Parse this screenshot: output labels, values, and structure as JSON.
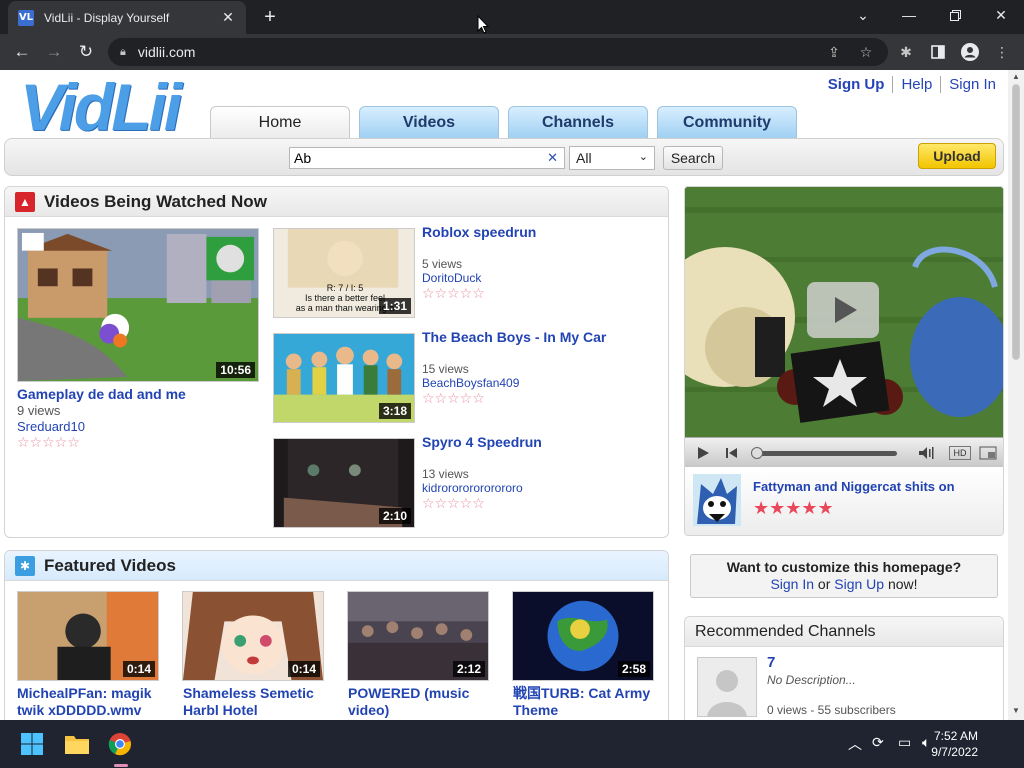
{
  "browser": {
    "tab_title": "VidLii - Display Yourself",
    "favicon_text": "VL",
    "url": "vidlii.com"
  },
  "site": {
    "logo": "VidLii",
    "user_links": {
      "signup": "Sign Up",
      "help": "Help",
      "signin": "Sign In"
    },
    "nav_tabs": [
      "Home",
      "Videos",
      "Channels",
      "Community"
    ],
    "active_tab": "Home",
    "search": {
      "value": "Ab",
      "clear": "✕",
      "category": "All",
      "button": "Search"
    },
    "upload": "Upload"
  },
  "watched_now": {
    "title": "Videos Being Watched Now",
    "main": {
      "title": "Gameplay de dad and me",
      "views": "9 views",
      "author": "Sreduard10",
      "duration": "10:56"
    },
    "list": [
      {
        "title": "Roblox speedrun",
        "views": "5 views",
        "author": "DoritoDuck",
        "duration": "1:31",
        "thumb_caption": "R: 7 / I: 5\nIs there a better feel\nas a man than wearing a"
      },
      {
        "title": "The Beach Boys - In My Car",
        "views": "15 views",
        "author": "BeachBoysfan409",
        "duration": "3:18"
      },
      {
        "title": "Spyro 4 Speedrun",
        "views": "13 views",
        "author": "kidrorororororororo",
        "duration": "2:10"
      }
    ]
  },
  "featured": {
    "title": "Featured Videos",
    "items": [
      {
        "title": "MichealPFan: magik twik xDDDDD.wmv",
        "duration": "0:14"
      },
      {
        "title": "Shameless Semetic Harbl Hotel",
        "duration": "0:14"
      },
      {
        "title": "POWERED (music video)",
        "duration": "2:12"
      },
      {
        "title": "戦国TURB: Cat Army Theme",
        "duration": "2:58"
      }
    ]
  },
  "player": {
    "now_playing": "Fattyman and Niggercat shits on",
    "stars_filled": 5,
    "hd": "HD"
  },
  "promo": {
    "question": "Want to customize this homepage?",
    "signin": "Sign In",
    "or": "or",
    "signup": "Sign Up",
    "now": "now!"
  },
  "recommended": {
    "title": "Recommended Channels",
    "channel": {
      "name": "7",
      "description": "No Description...",
      "stats": "0 views - 55 subscribers"
    }
  },
  "taskbar": {
    "time": "7:52 AM",
    "date": "9/7/2022"
  },
  "colors": {
    "link": "#2244b3",
    "logo": "#4c9ee6",
    "tab_gradient": "#9fd0f2",
    "upload": "#f2c500"
  }
}
